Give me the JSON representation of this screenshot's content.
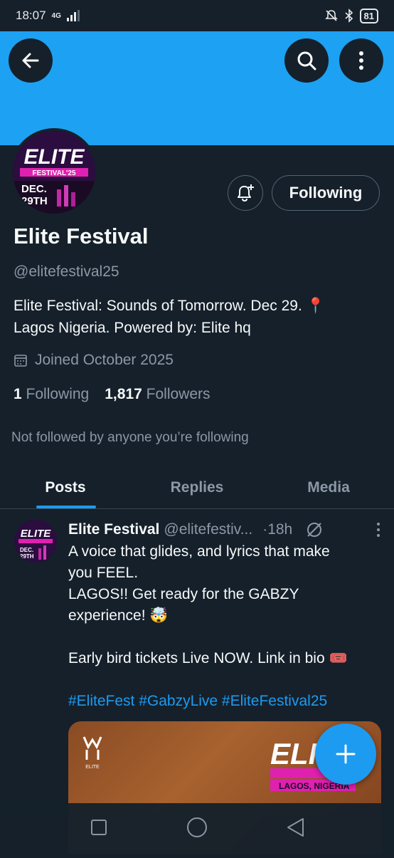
{
  "status_bar": {
    "time": "18:07",
    "network": "4G",
    "battery": "81"
  },
  "header": {
    "back_icon": "arrow-left-icon",
    "search_icon": "search-icon",
    "more_icon": "more-vertical-icon",
    "banner_color": "#1da1f2"
  },
  "avatar_badge": {
    "title": "ELITE",
    "subtitle": "FESTIVAL'25",
    "date_line1": "DEC.",
    "date_line2": "29TH"
  },
  "profile": {
    "name": "Elite Festival",
    "handle": "@elitefestival25",
    "bio_line1": "Elite Festival: Sounds of Tomorrow. Dec 29. 📍",
    "bio_line2": "Lagos Nigeria. Powered by: Elite hq",
    "joined": "Joined October 2025",
    "following_count": "1",
    "following_label": "Following",
    "followers_count": "1,817",
    "followers_label": "Followers",
    "not_followed_text": "Not followed by anyone you’re following",
    "follow_button": "Following"
  },
  "tabs": [
    {
      "label": "Posts",
      "active": true
    },
    {
      "label": "Replies",
      "active": false
    },
    {
      "label": "Media",
      "active": false
    }
  ],
  "post": {
    "author": "Elite Festival",
    "handle": "@elitefestiv...",
    "time": "·18h",
    "lines": [
      "A voice that glides, and lyrics that make",
      "you FEEL.",
      "LAGOS!! Get ready for the GABZY",
      "experience! 🤯",
      "",
      "Early bird tickets Live NOW. Link in bio 🎟️",
      ""
    ],
    "hashtags": "#EliteFest #GabzyLive #EliteFestival25",
    "media": {
      "brand": "ELITE",
      "location": "LAGOS, NIGERIA"
    }
  },
  "colors": {
    "background": "#15202b",
    "accent": "#1d9bf0",
    "muted": "#8b98a5"
  }
}
